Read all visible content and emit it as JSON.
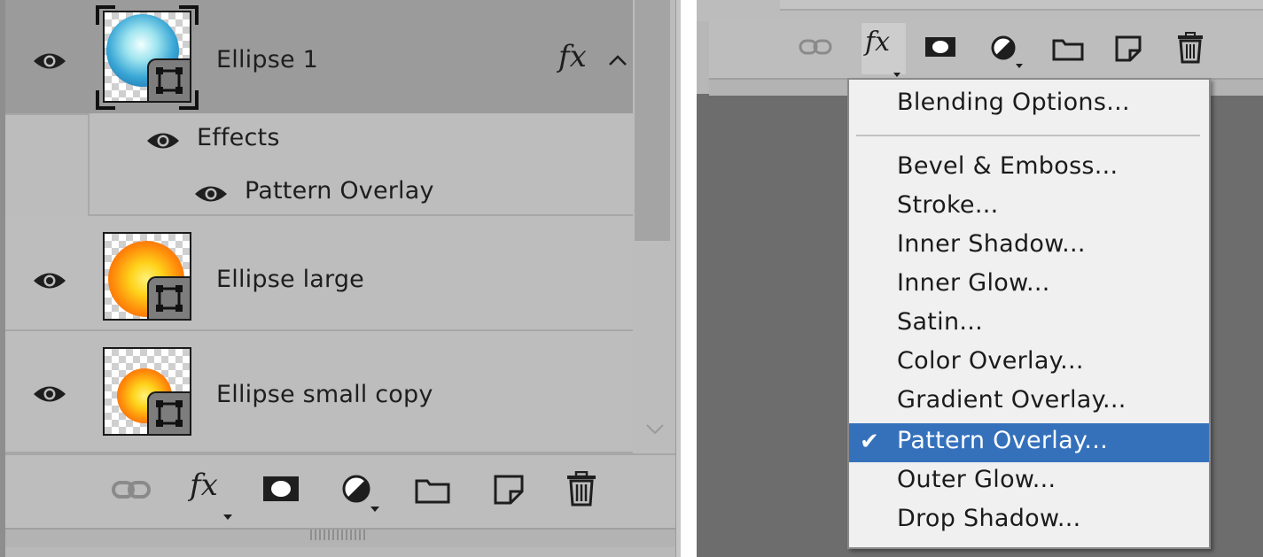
{
  "layers_panel": {
    "layers": [
      {
        "name": "Ellipse 1",
        "selected": true,
        "has_effects": true,
        "fx_badge": "fx",
        "visible": true
      },
      {
        "name": "Ellipse large",
        "selected": false,
        "visible": true
      },
      {
        "name": "Ellipse small copy",
        "selected": false,
        "visible": true
      }
    ],
    "effects_label": "Effects",
    "effect_items": [
      "Pattern Overlay"
    ],
    "bottom_toolbar": {
      "link": "link-icon",
      "fx": "fx",
      "mask": "layer-mask-icon",
      "adjustment": "adjustment-layer-icon",
      "group": "folder-icon",
      "new_layer": "new-layer-icon",
      "delete": "trash-icon"
    }
  },
  "fx_menu_panel": {
    "toolbar": {
      "fx": "fx",
      "icons": [
        "link-icon",
        "layer-mask-icon",
        "adjustment-layer-icon",
        "folder-icon",
        "new-layer-icon",
        "trash-icon"
      ]
    },
    "menu": {
      "header_item": "Blending Options...",
      "items": [
        "Bevel & Emboss...",
        "Stroke...",
        "Inner Shadow...",
        "Inner Glow...",
        "Satin...",
        "Color Overlay...",
        "Gradient Overlay...",
        "Pattern Overlay...",
        "Outer Glow...",
        "Drop Shadow..."
      ],
      "checked_item": "Pattern Overlay...",
      "check_mark": "✔"
    }
  },
  "colors": {
    "panel_bg": "#bdbdbd",
    "selected_row": "#9b9b9b",
    "menu_bg": "#f0f0f0",
    "menu_highlight": "#3571bb",
    "dark_bg": "#6d6d6d"
  }
}
